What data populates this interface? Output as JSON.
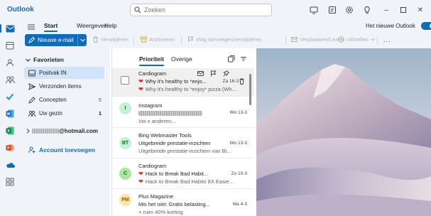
{
  "app": {
    "title": "Outlook"
  },
  "search": {
    "placeholder": "Zoeken"
  },
  "title_icons": [
    "meet-now-icon",
    "calendar-note-icon",
    "settings-icon",
    "tips-icon"
  ],
  "window_controls": [
    "minimize",
    "maximize",
    "close"
  ],
  "rail": [
    "mail-icon",
    "calendar-icon",
    "people-icon",
    "groups-icon",
    "todo-icon",
    "word-icon",
    "excel-icon",
    "powerpoint-icon",
    "onedrive-icon",
    "apps-icon"
  ],
  "ribbon": {
    "tabs": [
      "Start",
      "Weergeven",
      "Help"
    ],
    "new_outlook_label": "Het nieuwe Outlook",
    "new_outlook_on": true
  },
  "toolbar": {
    "new_mail": "Nieuwe e-mail",
    "delete": "Verwijderen",
    "archive": "Archiveren",
    "report": "Vlag toevoegen/verwijderen",
    "read_unread": "Verplaatsen/Lezen",
    "snooze": "Uitstellen",
    "more": "..."
  },
  "folders": {
    "favorites_label": "Favorieten",
    "items": [
      {
        "label": "Postvak IN",
        "count": "",
        "icon": "inbox-icon"
      },
      {
        "label": "Verzonden items",
        "count": "",
        "icon": "send-icon"
      },
      {
        "label": "Concepten",
        "count": "5",
        "icon": "draft-icon"
      },
      {
        "label": "Uw gezin",
        "count": "1",
        "icon": "family-icon"
      }
    ],
    "account": "@hotmail.com",
    "add_account": "Account toevoegen"
  },
  "list": {
    "tabs": [
      "Prioriteit",
      "Overige"
    ],
    "messages": [
      {
        "sender": "Cardiogram",
        "subject": "Why it's healthy to *enjo...",
        "preview": "Why it's healthy to *enjoy* pizza (Wh...",
        "date": "Za 16-3",
        "avatar": "",
        "avatar_color": "",
        "selected": true,
        "heart": true
      },
      {
        "sender": "Instagram",
        "subject": "",
        "preview": "Voi                     n anderen...",
        "date": "Wo 13-3",
        "avatar": "I",
        "avatar_color": "#c7f0d8",
        "selected": false,
        "heart": false
      },
      {
        "sender": "Bing Webmaster Tools",
        "subject": "Uitgebreide prestatie-inzichten",
        "preview": "Uitgebreide prestatie-inzichten van Bi...",
        "date": "Wo 13-3",
        "avatar": "BT",
        "avatar_color": "#c7f0d8",
        "selected": false,
        "heart": false
      },
      {
        "sender": "Cardiogram",
        "subject": "Hack to Break Bad Habit...",
        "preview": "Hack to Break Bad Habits 8X Easie...",
        "date": "Zo 10-3",
        "avatar": "C",
        "avatar_color": "#a8e6a1",
        "selected": false,
        "heart": true
      },
      {
        "sender": "Plus Magazine",
        "subject": "Mis het niet: Gratis belasting...",
        "preview": "+ ruim 40% korting",
        "date": "Ma 4-3",
        "avatar": "PM",
        "avatar_color": "#fde3a7",
        "selected": false,
        "heart": false
      }
    ]
  },
  "colors": {
    "accent": "#0f6cbd",
    "chrome": "#f0f4f9",
    "selected_folder": "#d1e3f8",
    "heart": "#d13438"
  }
}
